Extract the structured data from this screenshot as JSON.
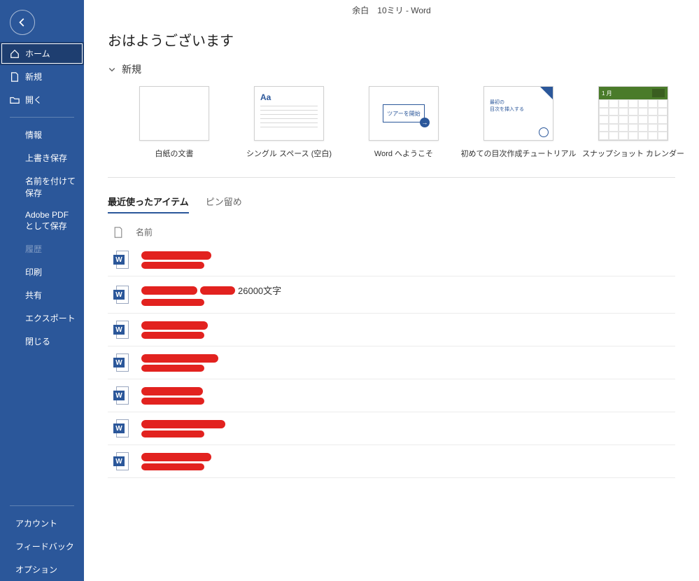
{
  "titlebar": "余白　10ミリ  -  Word",
  "greeting": "おはようございます",
  "sidebar": {
    "home": "ホーム",
    "new": "新規",
    "open": "開く",
    "info": "情報",
    "save": "上書き保存",
    "saveas": "名前を付けて保存",
    "adobepdf": "Adobe PDF として保存",
    "history": "履歴",
    "print": "印刷",
    "share": "共有",
    "export": "エクスポート",
    "close": "閉じる",
    "account": "アカウント",
    "feedback": "フィードバック",
    "options": "オプション"
  },
  "section_new": "新規",
  "templates": {
    "blank": "白紙の文書",
    "single": "シングル スペース (空白)",
    "welcome": "Word へようこそ",
    "welcome_thumb": "ツアーを開始",
    "toc": "初めての目次作成チュートリアル",
    "toc_thumb1": "最初の",
    "toc_thumb2": "目次を挿入する",
    "calendar": "スナップショット カレンダー",
    "cal_month": "1 月"
  },
  "tabs": {
    "recent": "最近使ったアイテム",
    "pinned": "ピン留め"
  },
  "list_hdr_name": "名前",
  "file_word_badge": "W",
  "file2_suffix": "26000文字",
  "aa": "Aa"
}
